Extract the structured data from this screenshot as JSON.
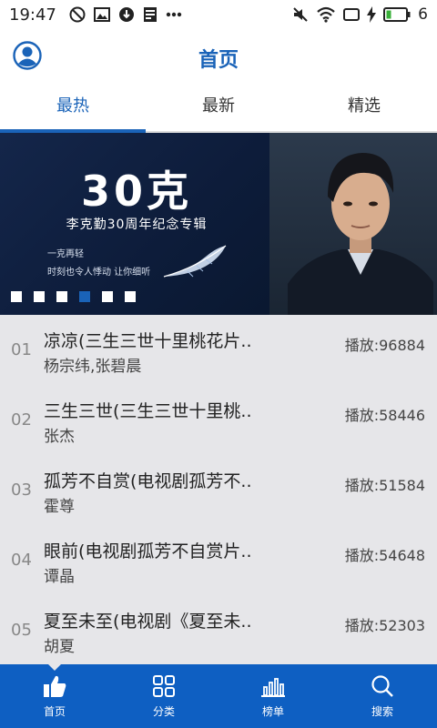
{
  "status_bar": {
    "time": "19:47",
    "battery_level": "6",
    "left_icons": [
      "no-disturb-icon",
      "image-icon",
      "download-icon",
      "news-icon",
      "more-icon"
    ],
    "right_icons": [
      "mute-icon",
      "wifi-icon",
      "screen-icon",
      "charging-icon",
      "battery-icon"
    ]
  },
  "header": {
    "title": "首页"
  },
  "tabs": [
    {
      "label": "最热",
      "active": true
    },
    {
      "label": "最新",
      "active": false
    },
    {
      "label": "精选",
      "active": false
    }
  ],
  "banner": {
    "headline": "30克",
    "subline": "李克勤30周年纪念专辑",
    "tagline_1": "一克再轻",
    "tagline_2": "时刻也令人悸动  让你细听",
    "dot_count": 6,
    "active_dot": 4
  },
  "songs": [
    {
      "rank": "01",
      "name": "凉凉(三生三世十里桃花片..",
      "artist": "杨宗纬,张碧晨",
      "plays": "播放:96884"
    },
    {
      "rank": "02",
      "name": "三生三世(三生三世十里桃..",
      "artist": "张杰",
      "plays": "播放:58446"
    },
    {
      "rank": "03",
      "name": "孤芳不自赏(电视剧孤芳不..",
      "artist": "霍尊",
      "plays": "播放:51584"
    },
    {
      "rank": "04",
      "name": "眼前(电视剧孤芳不自赏片..",
      "artist": "谭晶",
      "plays": "播放:54648"
    },
    {
      "rank": "05",
      "name": "夏至未至(电视剧《夏至未..",
      "artist": "胡夏",
      "plays": "播放:52303"
    }
  ],
  "bottom_nav": [
    {
      "label": "首页",
      "icon": "thumbs-up-icon",
      "active": true
    },
    {
      "label": "分类",
      "icon": "grid-icon",
      "active": false
    },
    {
      "label": "榜单",
      "icon": "chart-icon",
      "active": false
    },
    {
      "label": "搜索",
      "icon": "search-icon",
      "active": false
    }
  ],
  "colors": {
    "accent": "#1a63b8",
    "nav_bar": "#0e5fc2",
    "list_bg": "#e6e6e9"
  }
}
